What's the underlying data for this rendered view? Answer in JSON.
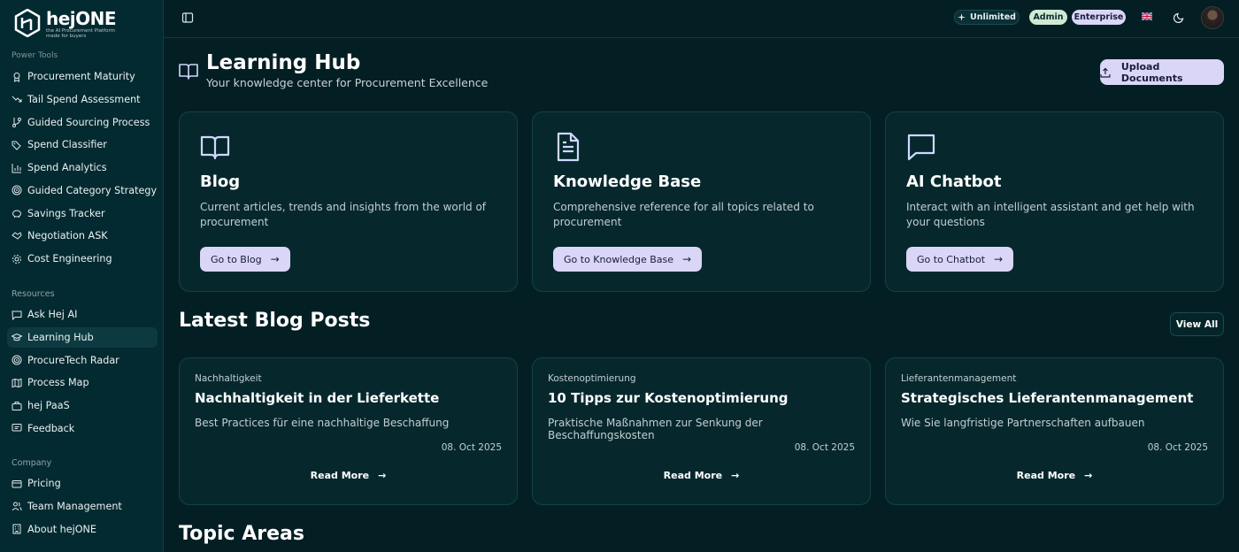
{
  "brand": {
    "name": "hejONE",
    "tagline_line1": "the AI Procurement Platform",
    "tagline_line2": "made for buyers"
  },
  "sidebar": {
    "cut_section_label": "Power Tools",
    "tools": [
      {
        "label": "Procurement Maturity",
        "icon": "award-icon"
      },
      {
        "label": "Tail Spend Assessment",
        "icon": "trending-down-icon"
      },
      {
        "label": "Guided Sourcing Process",
        "icon": "git-branch-icon"
      },
      {
        "label": "Spend Classifier",
        "icon": "tags-icon"
      },
      {
        "label": "Spend Analytics",
        "icon": "bar-chart-icon"
      },
      {
        "label": "Guided Category Strategy",
        "icon": "target-icon"
      },
      {
        "label": "Savings Tracker",
        "icon": "piggy-bank-icon"
      },
      {
        "label": "Negotiation ASK",
        "icon": "handshake-icon"
      },
      {
        "label": "Cost Engineering",
        "icon": "gear-icon"
      }
    ],
    "resources_label": "Resources",
    "resources": [
      {
        "label": "Ask Hej AI",
        "icon": "message-icon"
      },
      {
        "label": "Learning Hub",
        "icon": "graduation-cap-icon"
      },
      {
        "label": "ProcureTech Radar",
        "icon": "radar-icon"
      },
      {
        "label": "Process Map",
        "icon": "map-icon"
      },
      {
        "label": "hej PaaS",
        "icon": "briefcase-icon"
      },
      {
        "label": "Feedback",
        "icon": "feedback-icon"
      }
    ],
    "company_label": "Company",
    "company": [
      {
        "label": "Pricing",
        "icon": "wallet-icon"
      },
      {
        "label": "Team Management",
        "icon": "users-icon"
      },
      {
        "label": "About hejONE",
        "icon": "building-icon"
      }
    ]
  },
  "header": {
    "unlimited": "Unlimited",
    "admin": "Admin",
    "enterprise": "Enterprise"
  },
  "main": {
    "title": "Learning Hub",
    "subtitle": "Your knowledge center for Procurement Excellence",
    "upload_label": "Upload Documents",
    "features": [
      {
        "title": "Blog",
        "desc": "Current articles, trends and insights from the world of procurement",
        "button": "Go to Blog",
        "icon": "book-open-icon"
      },
      {
        "title": "Knowledge Base",
        "desc": "Comprehensive reference for all topics related to procurement",
        "button": "Go to Knowledge Base",
        "icon": "document-icon"
      },
      {
        "title": "AI Chatbot",
        "desc": "Interact with an intelligent assistant and get help with your questions",
        "button": "Go to Chatbot",
        "icon": "chat-bubble-icon"
      }
    ],
    "latest_title": "Latest Blog Posts",
    "view_all": "View All",
    "posts": [
      {
        "category": "Nachhaltigkeit",
        "title": "Nachhaltigkeit in der Lieferkette",
        "desc": "Best Practices für eine nachhaltige Beschaffung",
        "date": "08. Oct 2025",
        "read_more": "Read More"
      },
      {
        "category": "Kostenoptimierung",
        "title": "10 Tipps zur Kostenoptimierung",
        "desc": "Praktische Maßnahmen zur Senkung der Beschaffungskosten",
        "date": "08. Oct 2025",
        "read_more": "Read More"
      },
      {
        "category": "Lieferantenmanagement",
        "title": "Strategisches Lieferantenmanagement",
        "desc": "Wie Sie langfristige Partnerschaften aufbauen",
        "date": "08. Oct 2025",
        "read_more": "Read More"
      }
    ],
    "topic_title": "Topic Areas"
  },
  "colors": {
    "background": "#041f24",
    "sidebar": "#032a30",
    "card": "#06282d",
    "accent_lavender": "#d9d6f7",
    "accent_mint": "#cfe9d4"
  }
}
